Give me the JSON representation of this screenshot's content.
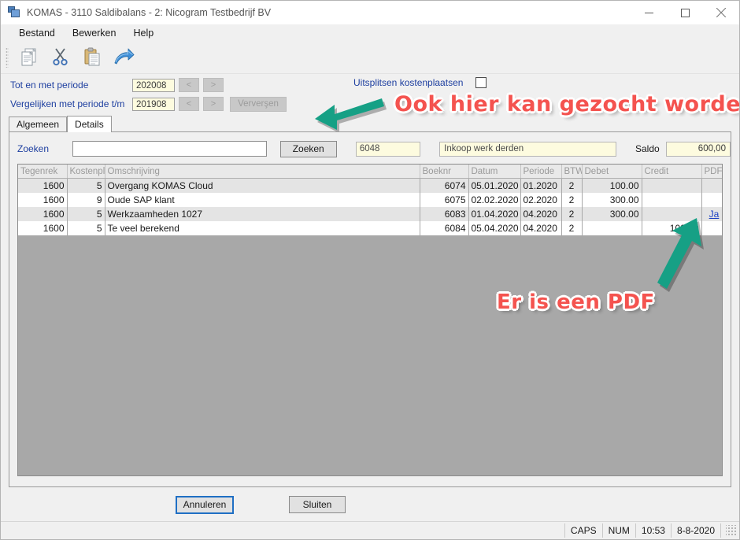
{
  "window": {
    "title": "KOMAS - 3110 Saldibalans - 2: Nicogram Testbedrijf BV",
    "app_icon": "window-stack-icon",
    "controls": {
      "minimize": "minimize-icon",
      "maximize": "maximize-icon",
      "close": "close-icon"
    }
  },
  "menu": {
    "items": [
      {
        "label": "Bestand"
      },
      {
        "label": "Bewerken"
      },
      {
        "label": "Help"
      }
    ]
  },
  "toolbar": {
    "buttons": [
      {
        "icon": "copy-icon",
        "name": "copy-button"
      },
      {
        "icon": "cut-scissors-icon",
        "name": "cut-button"
      },
      {
        "icon": "paste-clipboard-icon",
        "name": "paste-button"
      },
      {
        "icon": "undo-arrow-icon",
        "name": "undo-button"
      }
    ]
  },
  "period": {
    "row1": {
      "label": "Tot en met periode",
      "value": "202008",
      "prev_label": "<",
      "next_label": ">"
    },
    "row2": {
      "label": "Vergelijken met periode t/m",
      "value": "201908",
      "prev_label": "<",
      "next_label": ">",
      "refresh_label": "Ververşen"
    }
  },
  "split_costs": {
    "label": "Uitsplitsen kostenplaatsen",
    "checked": false
  },
  "tabs": [
    {
      "label": "Algemeen",
      "active": false
    },
    {
      "label": "Details",
      "active": true
    }
  ],
  "search": {
    "label": "Zoeken",
    "value": "",
    "placeholder": "",
    "button_label": "Zoeken",
    "account_code": "6048",
    "account_name": "Inkoop werk derden",
    "saldo_label": "Saldo",
    "saldo_value": "600,00"
  },
  "grid": {
    "columns": [
      "Tegenrek",
      "Kostenpl",
      "Omschrijving",
      "Boeknr",
      "Datum",
      "Periode",
      "BTW",
      "Debet",
      "Credit",
      "PDF"
    ],
    "rows": [
      {
        "tegenrek": "1600",
        "kostenpl": "5",
        "omschrijving": "Overgang KOMAS Cloud",
        "boeknr": "6074",
        "datum": "05.01.2020",
        "periode": "01.2020",
        "btw": "2",
        "debet": "100.00",
        "credit": "",
        "pdf": ""
      },
      {
        "tegenrek": "1600",
        "kostenpl": "9",
        "omschrijving": "Oude SAP klant",
        "boeknr": "6075",
        "datum": "02.02.2020",
        "periode": "02.2020",
        "btw": "2",
        "debet": "300.00",
        "credit": "",
        "pdf": ""
      },
      {
        "tegenrek": "1600",
        "kostenpl": "5",
        "omschrijving": "Werkzaamheden 1027",
        "boeknr": "6083",
        "datum": "01.04.2020",
        "periode": "04.2020",
        "btw": "2",
        "debet": "300.00",
        "credit": "",
        "pdf": "Ja"
      },
      {
        "tegenrek": "1600",
        "kostenpl": "5",
        "omschrijving": "Te veel berekend",
        "boeknr": "6084",
        "datum": "05.04.2020",
        "periode": "04.2020",
        "btw": "2",
        "debet": "",
        "credit": "100.00",
        "pdf": ""
      }
    ]
  },
  "footer": {
    "cancel_label": "Annuleren",
    "close_label": "Sluiten"
  },
  "status_bar": {
    "caps": "CAPS",
    "num": "NUM",
    "time": "10:53",
    "date": "8-8-2020"
  },
  "annotations": {
    "search_note": "Ook hier kan gezocht worden",
    "pdf_note": "Er is een PDF",
    "color": "#f4534f",
    "arrow_color": "#16a085"
  }
}
